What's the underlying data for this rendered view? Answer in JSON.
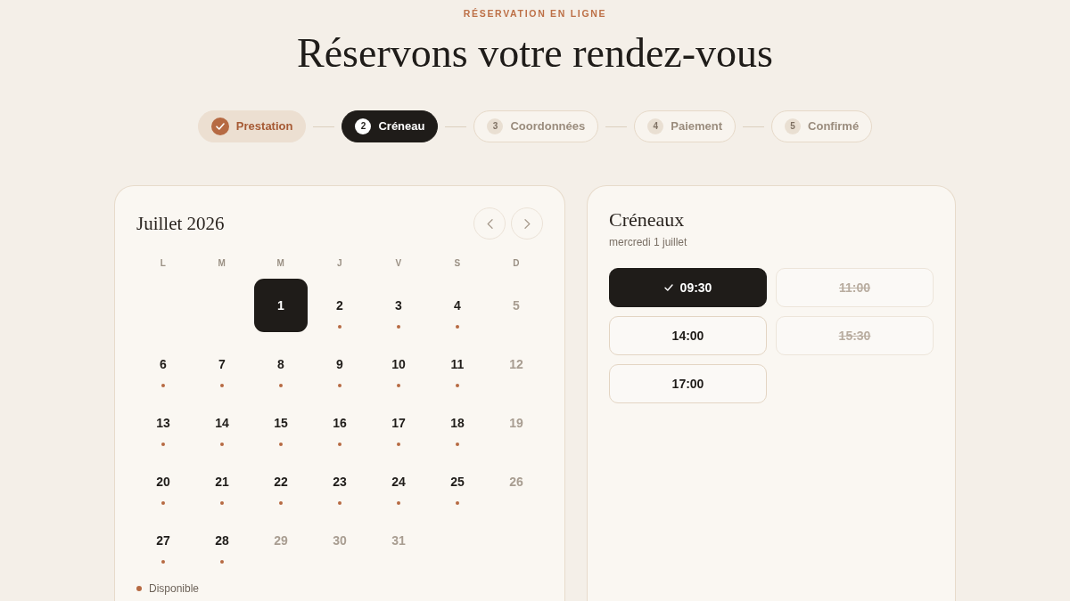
{
  "header": {
    "eyebrow": "RÉSERVATION EN LIGNE",
    "title": "Réservons votre rendez-vous"
  },
  "steps": [
    {
      "label": "Prestation",
      "completed": true,
      "selected": false
    },
    {
      "number": "2",
      "label": "Créneau",
      "completed": false,
      "selected": true
    },
    {
      "number": "3",
      "label": "Coordonnées",
      "completed": false,
      "selected": false
    },
    {
      "number": "4",
      "label": "Paiement",
      "completed": false,
      "selected": false
    },
    {
      "number": "5",
      "label": "Confirmé",
      "completed": false,
      "selected": false
    }
  ],
  "calendar": {
    "month": "Juillet 2026",
    "weekdays": [
      "L",
      "M",
      "M",
      "J",
      "V",
      "S",
      "D"
    ],
    "weeks": [
      {
        "days": [
          {
            "label": "1",
            "selected": true,
            "available": true
          },
          {
            "label": "2",
            "selected": false,
            "available": true
          },
          {
            "label": "3",
            "selected": false,
            "available": true
          },
          {
            "label": "4",
            "selected": false,
            "available": true
          },
          {
            "label": "5",
            "selected": false,
            "available": false
          }
        ]
      },
      {
        "days": [
          {
            "label": "6",
            "selected": false,
            "available": true
          },
          {
            "label": "7",
            "selected": false,
            "available": true
          },
          {
            "label": "8",
            "selected": false,
            "available": true
          },
          {
            "label": "9",
            "selected": false,
            "available": true
          },
          {
            "label": "10",
            "selected": false,
            "available": true
          },
          {
            "label": "11",
            "selected": false,
            "available": true
          },
          {
            "label": "12",
            "selected": false,
            "available": false
          }
        ]
      },
      {
        "days": [
          {
            "label": "13",
            "selected": false,
            "available": true
          },
          {
            "label": "14",
            "selected": false,
            "available": true
          },
          {
            "label": "15",
            "selected": false,
            "available": true
          },
          {
            "label": "16",
            "selected": false,
            "available": true
          },
          {
            "label": "17",
            "selected": false,
            "available": true
          },
          {
            "label": "18",
            "selected": false,
            "available": true
          },
          {
            "label": "19",
            "selected": false,
            "available": false
          }
        ]
      },
      {
        "days": [
          {
            "label": "20",
            "selected": false,
            "available": true
          },
          {
            "label": "21",
            "selected": false,
            "available": true
          },
          {
            "label": "22",
            "selected": false,
            "available": true
          },
          {
            "label": "23",
            "selected": false,
            "available": true
          },
          {
            "label": "24",
            "selected": false,
            "available": true
          },
          {
            "label": "25",
            "selected": false,
            "available": true
          },
          {
            "label": "26",
            "selected": false,
            "available": false
          }
        ]
      },
      {
        "days": [
          {
            "label": "27",
            "selected": false,
            "available": true
          },
          {
            "label": "28",
            "selected": false,
            "available": true
          },
          {
            "label": "29",
            "selected": false,
            "available": false
          },
          {
            "label": "30",
            "selected": false,
            "available": false
          },
          {
            "label": "31",
            "selected": false,
            "available": false
          }
        ]
      }
    ],
    "legend": {
      "label": "Disponible"
    }
  },
  "slots_panel": {
    "title": "Créneaux",
    "date": "mercredi 1 juillet",
    "slots": [
      {
        "time": "09:30",
        "selected": true,
        "disabled": false
      },
      {
        "time": "11:00",
        "selected": false,
        "disabled": true
      },
      {
        "time": "14:00",
        "selected": false,
        "disabled": false
      },
      {
        "time": "15:30",
        "selected": false,
        "disabled": true
      },
      {
        "time": "17:00",
        "selected": false,
        "disabled": false
      }
    ]
  }
}
